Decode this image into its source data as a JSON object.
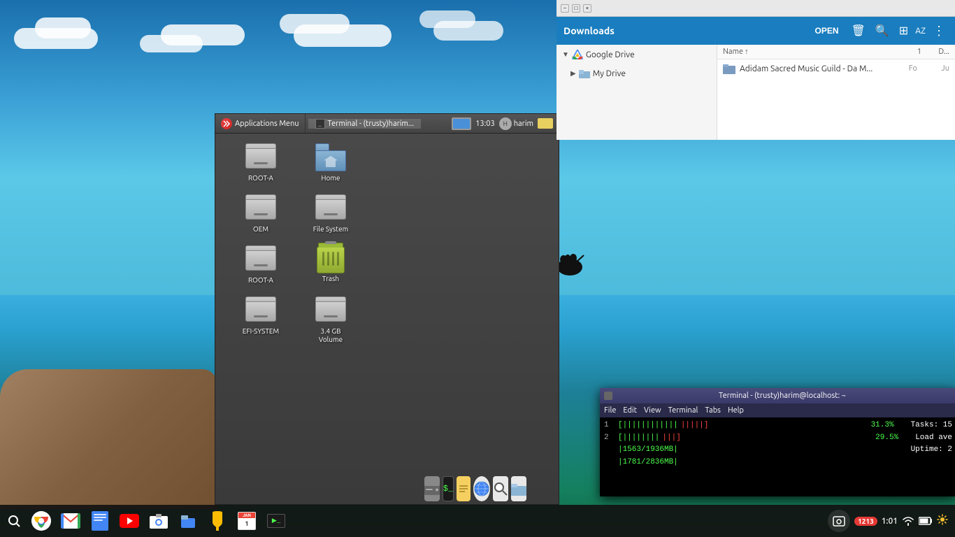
{
  "desktop": {
    "background": "ocean-scene"
  },
  "top_panel": {
    "app_menu_label": "Applications Menu",
    "terminal_label": "Terminal - (trusty)harim...",
    "time": "13:03",
    "username": "harim"
  },
  "file_manager": {
    "title": "Downloads",
    "toolbar": {
      "open_btn": "OPEN",
      "delete_icon": "🗑",
      "search_icon": "🔍",
      "grid_icon": "⊞",
      "az_label": "AZ",
      "menu_icon": "⋮"
    },
    "sidebar": {
      "items": [
        {
          "label": "Google Drive",
          "indent": 0,
          "arrow": "▼",
          "icon": "drive"
        },
        {
          "label": "My Drive",
          "indent": 1,
          "arrow": "▶",
          "icon": "folder"
        }
      ]
    },
    "content": {
      "columns": [
        {
          "label": "Name",
          "sort": "↑",
          "col_num": "1"
        },
        {
          "label": "D..."
        }
      ],
      "rows": [
        {
          "name": "Adidam Sacred Music Guild - Da M...",
          "col2": "Fo",
          "col3": "Ju"
        }
      ]
    }
  },
  "desktop_icons": [
    {
      "id": "root-a-1",
      "label": "ROOT-A",
      "type": "hdd"
    },
    {
      "id": "home",
      "label": "Home",
      "type": "folder"
    },
    {
      "id": "oem",
      "label": "OEM",
      "type": "hdd"
    },
    {
      "id": "file-system",
      "label": "File System",
      "type": "hdd"
    },
    {
      "id": "root-a-2",
      "label": "ROOT-A",
      "type": "hdd"
    },
    {
      "id": "trash",
      "label": "Trash",
      "type": "trash"
    },
    {
      "id": "efi-system",
      "label": "EFI-SYSTEM",
      "type": "hdd"
    },
    {
      "id": "volume",
      "label": "3.4 GB\nVolume",
      "type": "hdd"
    }
  ],
  "xfce_panel": {
    "app_menu": "Applications Menu",
    "terminal_tab": "Terminal - (trusty)harim..."
  },
  "terminal": {
    "title": "Terminal - (trusty)harim@localhost: ~",
    "menu_items": [
      "File",
      "Edit",
      "View",
      "Terminal",
      "Tabs",
      "Help"
    ],
    "lines": [
      {
        "num": "1",
        "bars": "||||||||||||",
        "pct": "31.3%",
        "right": "Tasks: 15"
      },
      {
        "num": "2",
        "bars": "||||||||",
        "pct": "29.5%",
        "right": "Load ave"
      },
      {
        "num": "",
        "bars": "|1563/1936MB|",
        "pct": "",
        "right": "Uptime: 2"
      },
      {
        "num": "",
        "bars": "|1781/2836MB|",
        "pct": "",
        "right": ""
      }
    ]
  },
  "dock": {
    "icons": [
      {
        "id": "hdd-dock",
        "type": "hdd-gray"
      },
      {
        "id": "terminal-dock",
        "type": "terminal"
      },
      {
        "id": "notes-dock",
        "type": "notes"
      },
      {
        "id": "globe-dock",
        "type": "globe"
      },
      {
        "id": "search-dock",
        "type": "search"
      },
      {
        "id": "files-dock",
        "type": "files"
      }
    ]
  },
  "bottom_bar": {
    "badge_num": "1213",
    "time": "1:01",
    "wifi": "wifi",
    "battery": "🔋"
  }
}
